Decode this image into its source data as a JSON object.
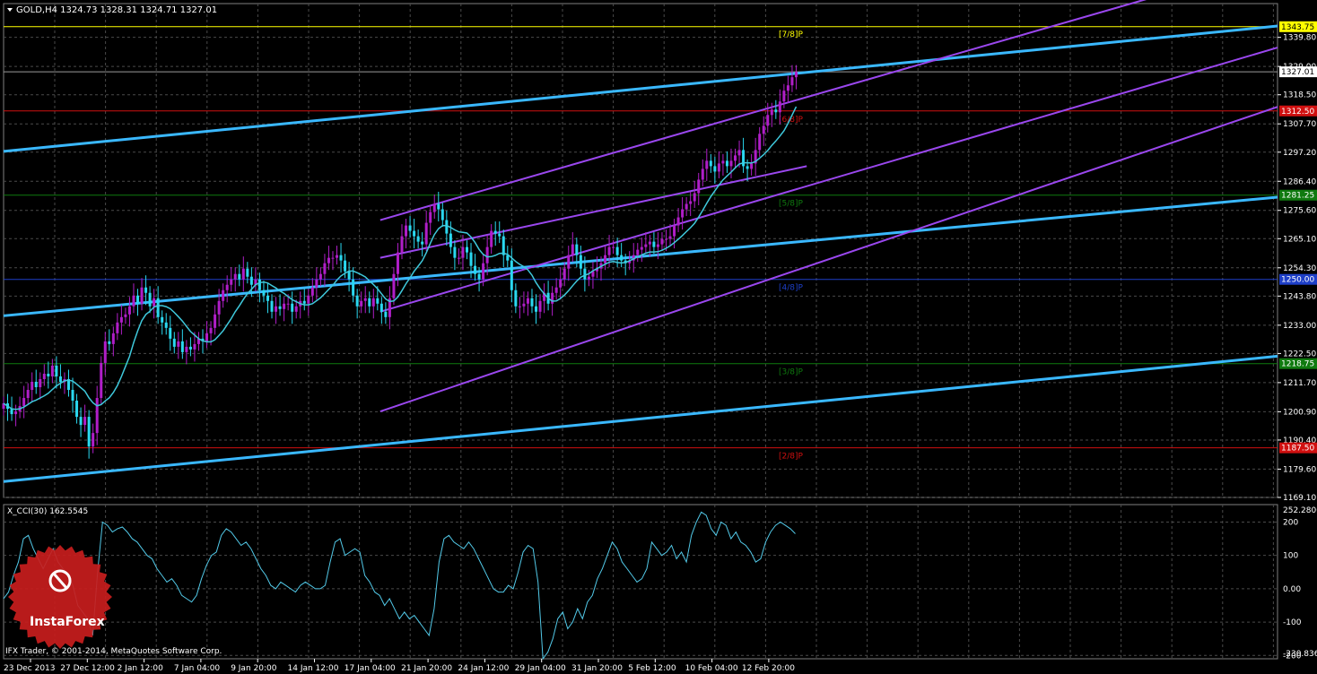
{
  "window": {
    "header": "GOLD,H4  1324.73 1328.31 1324.71 1327.01",
    "indicator_header": "X_CCI(30) 162.5545",
    "copyright": "IFX Trader, © 2001-2014, MetaQuotes Software Corp.",
    "logo_text": "InstaForex"
  },
  "colors": {
    "background": "#000000",
    "grid": "#4a4a4a",
    "bull_candle": "#b01ec8",
    "bear_candle": "#2ad8f0",
    "ma": "#3fc9dc",
    "cyan_line": "#3ab8ff",
    "channel": "#9a47ee",
    "cci": "#52c9e8",
    "axis_text": "#ffffff",
    "logo": "#c81d1d"
  },
  "chart_data": [
    {
      "type": "candlestick",
      "symbol": "GOLD",
      "timeframe": "H4",
      "quote": {
        "open": 1324.73,
        "high": 1328.31,
        "low": 1324.71,
        "close": 1327.01
      },
      "ylim": [
        1169.1,
        1349.0
      ],
      "y_ticks": [
        "1339.80",
        "1329.00",
        "1318.50",
        "1307.70",
        "1297.20",
        "1286.40",
        "1275.60",
        "1265.10",
        "1254.30",
        "1243.80",
        "1233.00",
        "1222.50",
        "1211.70",
        "1200.90",
        "1190.40",
        "1179.60",
        "1169.10"
      ],
      "x_labels": [
        "23 Dec 2013",
        "27 Dec 12:00",
        "2 Jan 12:00",
        "7 Jan 04:00",
        "9 Jan 20:00",
        "14 Jan 12:00",
        "17 Jan 04:00",
        "21 Jan 20:00",
        "24 Jan 12:00",
        "29 Jan 04:00",
        "31 Jan 20:00",
        "5 Feb 12:00",
        "10 Feb 04:00",
        "12 Feb 20:00"
      ],
      "current_price_label": "1327.01",
      "levels": [
        {
          "name": "[7/8]P",
          "value": 1343.75,
          "label": "1343.75",
          "color": "#ffff00",
          "text_color": "#000000"
        },
        {
          "name": "[6/8]P",
          "value": 1312.5,
          "label": "1312.50",
          "color": "#d01010",
          "text_color": "#ffffff"
        },
        {
          "name": "[5/8]P",
          "value": 1281.25,
          "label": "1281.25",
          "color": "#0f7a0f",
          "text_color": "#ffffff"
        },
        {
          "name": "[4/8]P",
          "value": 1250.0,
          "label": "1250.00",
          "color": "#1e3fc8",
          "text_color": "#ffffff"
        },
        {
          "name": "[3/8]P",
          "value": 1218.75,
          "label": "1218.75",
          "color": "#0f7a0f",
          "text_color": "#ffffff"
        },
        {
          "name": "[2/8]P",
          "value": 1187.5,
          "label": "1187.50",
          "color": "#d01010",
          "text_color": "#ffffff"
        }
      ],
      "series_close": [
        1204,
        1202,
        1200,
        1201,
        1203,
        1206,
        1209,
        1212,
        1210,
        1213,
        1215,
        1214,
        1218,
        1214,
        1212,
        1213,
        1209,
        1205,
        1199,
        1196,
        1199,
        1188,
        1193,
        1206,
        1219,
        1227,
        1226,
        1230,
        1234,
        1236,
        1237,
        1240,
        1244,
        1241,
        1247,
        1245,
        1240,
        1243,
        1236,
        1234,
        1232,
        1228,
        1225,
        1227,
        1223,
        1225,
        1224,
        1226,
        1228,
        1227,
        1230,
        1232,
        1237,
        1242,
        1246,
        1248,
        1250,
        1252,
        1250,
        1254,
        1251,
        1248,
        1250,
        1246,
        1244,
        1242,
        1238,
        1240,
        1239,
        1241,
        1241,
        1238,
        1240,
        1242,
        1241,
        1244,
        1247,
        1250,
        1252,
        1256,
        1258,
        1258,
        1259,
        1257,
        1253,
        1250,
        1244,
        1240,
        1242,
        1243,
        1240,
        1243,
        1241,
        1238,
        1236,
        1243,
        1252,
        1260,
        1266,
        1270,
        1268,
        1266,
        1264,
        1263,
        1271,
        1275,
        1278,
        1276,
        1272,
        1267,
        1262,
        1258,
        1258,
        1262,
        1260,
        1255,
        1252,
        1250,
        1256,
        1262,
        1268,
        1267,
        1266,
        1259,
        1257,
        1246,
        1240,
        1240,
        1241,
        1243,
        1240,
        1238,
        1242,
        1245,
        1241,
        1245,
        1247,
        1250,
        1254,
        1259,
        1263,
        1259,
        1254,
        1250,
        1251,
        1253,
        1254,
        1256,
        1259,
        1262,
        1262,
        1259,
        1257,
        1256,
        1257,
        1259,
        1261,
        1262,
        1263,
        1264,
        1262,
        1263,
        1265,
        1265,
        1266,
        1270,
        1273,
        1276,
        1278,
        1279,
        1282,
        1287,
        1291,
        1294,
        1292,
        1290,
        1293,
        1294,
        1292,
        1294,
        1296,
        1298,
        1292,
        1291,
        1293,
        1298,
        1304,
        1307,
        1311,
        1313,
        1312,
        1316,
        1320,
        1322,
        1325,
        1327
      ],
      "ma_range": {
        "start_value": 1219,
        "end_value": 1292,
        "start_x_index": 0,
        "end_x_index": 200
      },
      "trend_lines": [
        {
          "name": "cyan-line-1",
          "from": [
            0,
            1297.5
          ],
          "to": [
            230,
            1344
          ]
        },
        {
          "name": "cyan-line-2",
          "from": [
            0,
            1236.5
          ],
          "to": [
            230,
            1280.5
          ]
        },
        {
          "name": "cyan-line-3",
          "from": [
            0,
            1175
          ],
          "to": [
            230,
            1221.5
          ]
        },
        {
          "name": "channel-upper",
          "from": [
            68,
            1272
          ],
          "to": [
            230,
            1368
          ]
        },
        {
          "name": "channel-mid",
          "from": [
            68,
            1238
          ],
          "to": [
            230,
            1336
          ]
        },
        {
          "name": "channel-mid2",
          "from": [
            68,
            1258
          ],
          "to": [
            145,
            1292
          ]
        },
        {
          "name": "channel-lower",
          "from": [
            68,
            1201
          ],
          "to": [
            230,
            1314
          ]
        }
      ]
    },
    {
      "type": "line",
      "name": "X_CCI(30)",
      "ylim": [
        -210,
        252.2806
      ],
      "y_ticks": [
        "252.2806",
        "200",
        "100",
        "0.00",
        "-100",
        "-200",
        "-230.836"
      ],
      "values": [
        -30,
        -10,
        40,
        80,
        150,
        160,
        120,
        90,
        60,
        90,
        120,
        80,
        60,
        40,
        10,
        -50,
        -70,
        -90,
        -140,
        50,
        200,
        190,
        170,
        180,
        185,
        170,
        150,
        140,
        120,
        100,
        90,
        60,
        40,
        20,
        30,
        10,
        -20,
        -30,
        -40,
        -20,
        30,
        70,
        100,
        110,
        160,
        180,
        170,
        150,
        130,
        140,
        120,
        90,
        60,
        40,
        10,
        0,
        20,
        10,
        0,
        -10,
        10,
        20,
        10,
        0,
        0,
        10,
        80,
        140,
        150,
        100,
        110,
        120,
        110,
        40,
        20,
        -10,
        -20,
        -50,
        -30,
        -60,
        -90,
        -70,
        -90,
        -80,
        -100,
        -120,
        -140,
        -60,
        80,
        150,
        160,
        140,
        130,
        120,
        140,
        120,
        90,
        60,
        30,
        0,
        -10,
        -10,
        10,
        0,
        50,
        110,
        130,
        120,
        20,
        -210,
        -190,
        -150,
        -90,
        -70,
        -120,
        -100,
        -60,
        -90,
        -40,
        -20,
        30,
        60,
        100,
        140,
        120,
        80,
        60,
        40,
        20,
        30,
        60,
        140,
        120,
        100,
        110,
        130,
        90,
        110,
        80,
        160,
        200,
        230,
        220,
        180,
        160,
        200,
        190,
        150,
        170,
        140,
        130,
        110,
        80,
        90,
        140,
        170,
        190,
        200,
        190,
        180,
        165
      ]
    }
  ]
}
